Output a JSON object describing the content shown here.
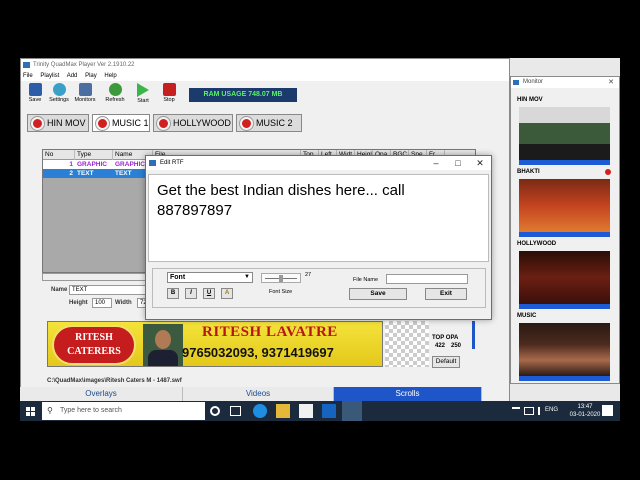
{
  "main_window": {
    "title": "Trinity QuadMax Player Ver 2.1910.22",
    "menu": [
      "File",
      "Playlist",
      "Add",
      "Play",
      "Help"
    ],
    "toolbar": [
      "Save",
      "Settings",
      "Monitors",
      "Refresh",
      "Start",
      "Stop"
    ],
    "ram_usage": "RAM USAGE     748.07 MB",
    "tabs": [
      "HIN MOV",
      "MUSIC 1",
      "HOLLYWOOD",
      "MUSIC 2"
    ],
    "active_tab": "MUSIC 1",
    "table": {
      "columns": [
        "No",
        "Type",
        "Name",
        "File",
        "Top",
        "Left",
        "Widt",
        "Heigl",
        "Opa",
        "BGC",
        "Spe",
        "Fr"
      ],
      "rows": [
        {
          "no": "1",
          "type": "GRAPHIC",
          "name": "GRAPHIC"
        },
        {
          "no": "2",
          "type": "TEXT",
          "name": "TEXT"
        }
      ]
    },
    "properties": {
      "name_label": "Name",
      "name_value": "TEXT",
      "height_label": "Height",
      "height_value": "100",
      "width_label": "Width",
      "width_value": "720"
    },
    "banner": {
      "logo_line1": "RITESH",
      "logo_line2": "CATERERS",
      "name": "RITESH LAVATRE",
      "phone": "9765032093, 9371419697"
    },
    "side_info": {
      "header": "TOP OPA",
      "top_value": "422",
      "opa_value": "250",
      "default_button": "Default"
    },
    "file_path": "C:\\QuadMax\\images\\Ritesh Caters M - 1487.swf",
    "bottom_tabs": [
      "Overlays",
      "Videos",
      "Scrolls"
    ],
    "selected_bottom_tab": "Scrolls"
  },
  "dialog": {
    "title": "Edit RTF",
    "text": "Get the best Indian dishes here... call 887897897",
    "font_label": "Font",
    "font_size_label": "Font Size",
    "font_size_value": "27",
    "format_buttons": [
      "B",
      "I",
      "U",
      "A"
    ],
    "file_name_label": "File Name",
    "save_label": "Save",
    "exit_label": "Exit"
  },
  "monitor": {
    "title": "Monitor",
    "channels": [
      {
        "label": "HIN MOV",
        "color": "#3a5a3a"
      },
      {
        "label": "BHAKTI",
        "color": "#c44420"
      },
      {
        "label": "HOLLYWOOD",
        "color": "#6b1f12"
      },
      {
        "label": "MUSIC",
        "color": "#4b2a1e"
      }
    ]
  },
  "taskbar": {
    "search_placeholder": "Type here to search",
    "language": "ENG",
    "time": "13:47",
    "date": "03-01-2020"
  },
  "colors": {
    "accent": "#1e55c9",
    "ram_bg": "#1a3b6b",
    "ram_text": "#5cf26b",
    "graphic_row": "#9b1fd1",
    "selected_row": "#2b7fd4"
  }
}
